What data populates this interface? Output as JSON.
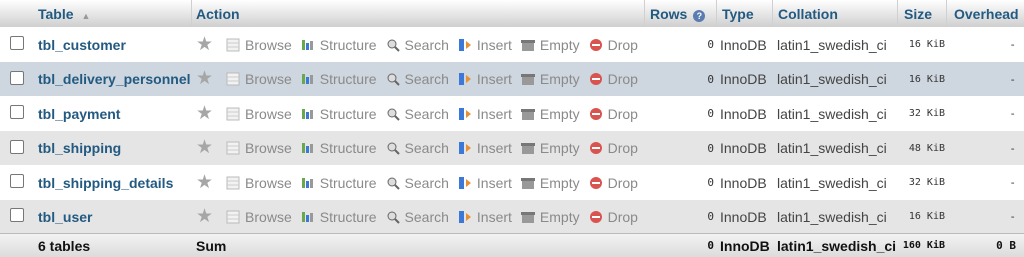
{
  "header": {
    "table": "Table",
    "action": "Action",
    "rows": "Rows",
    "type": "Type",
    "collation": "Collation",
    "size": "Size",
    "overhead": "Overhead"
  },
  "actions": {
    "browse": "Browse",
    "structure": "Structure",
    "search": "Search",
    "insert": "Insert",
    "empty": "Empty",
    "drop": "Drop"
  },
  "rows": [
    {
      "name": "tbl_customer",
      "rows": "0",
      "type": "InnoDB",
      "collation": "latin1_swedish_ci",
      "size": "16 KiB",
      "overhead": "-"
    },
    {
      "name": "tbl_delivery_personnel",
      "rows": "0",
      "type": "InnoDB",
      "collation": "latin1_swedish_ci",
      "size": "16 KiB",
      "overhead": "-"
    },
    {
      "name": "tbl_payment",
      "rows": "0",
      "type": "InnoDB",
      "collation": "latin1_swedish_ci",
      "size": "32 KiB",
      "overhead": "-"
    },
    {
      "name": "tbl_shipping",
      "rows": "0",
      "type": "InnoDB",
      "collation": "latin1_swedish_ci",
      "size": "48 KiB",
      "overhead": "-"
    },
    {
      "name": "tbl_shipping_details",
      "rows": "0",
      "type": "InnoDB",
      "collation": "latin1_swedish_ci",
      "size": "32 KiB",
      "overhead": "-"
    },
    {
      "name": "tbl_user",
      "rows": "0",
      "type": "InnoDB",
      "collation": "latin1_swedish_ci",
      "size": "16 KiB",
      "overhead": "-"
    }
  ],
  "footer": {
    "tables": "6 tables",
    "sum": "Sum",
    "rows": "0",
    "type": "InnoDB",
    "collation": "latin1_swedish_ci",
    "size": "160 KiB",
    "overhead": "0 B"
  },
  "icons": {
    "favorite": "star-icon",
    "browse": "browse-icon",
    "structure": "structure-icon",
    "search": "search-icon",
    "insert": "insert-icon",
    "empty": "empty-icon",
    "drop": "drop-icon",
    "sort": "sort-asc-icon",
    "help": "help-icon"
  },
  "colors": {
    "link": "#235a81",
    "drop_red": "#d9534f",
    "row_highlight": "#ced6df"
  }
}
